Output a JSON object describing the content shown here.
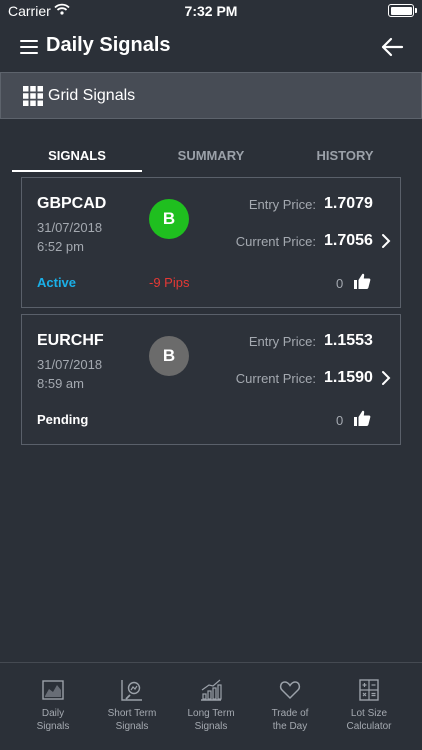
{
  "status_bar": {
    "carrier": "Carrier",
    "time": "7:32 PM"
  },
  "nav": {
    "title": "Daily Signals",
    "menu_icon": "hamburger-menu-icon",
    "back_icon": "arrow-left-icon"
  },
  "sub_header": {
    "label": "Grid Signals",
    "icon": "grid-icon"
  },
  "tabs": [
    {
      "label": "SIGNALS",
      "active": true
    },
    {
      "label": "SUMMARY",
      "active": false
    },
    {
      "label": "HISTORY",
      "active": false
    }
  ],
  "signals": [
    {
      "pair": "GBPCAD",
      "date": "31/07/2018",
      "time": "6:52 pm",
      "badge": "B",
      "badge_color": "#1fbf1f",
      "entry_label": "Entry Price:",
      "entry_price": "1.7079",
      "current_label": "Current Price:",
      "current_price": "1.7056",
      "status": "Active",
      "status_color": "#1ab0e8",
      "pips": "-9 Pips",
      "pips_color": "#e53935",
      "likes": "0"
    },
    {
      "pair": "EURCHF",
      "date": "31/07/2018",
      "time": "8:59 am",
      "badge": "B",
      "badge_color": "#6b6b6b",
      "entry_label": "Entry Price:",
      "entry_price": "1.1553",
      "current_label": "Current Price:",
      "current_price": "1.1590",
      "status": "Pending",
      "status_color": "#ffffff",
      "pips": "",
      "likes": "0"
    }
  ],
  "bottom_nav": [
    {
      "label": "Daily\nSignals",
      "icon": "chart-area-icon"
    },
    {
      "label": "Short Term\nSignals",
      "icon": "chart-magnifier-icon"
    },
    {
      "label": "Long Term\nSignals",
      "icon": "bar-chart-rising-icon"
    },
    {
      "label": "Trade of\nthe Day",
      "icon": "heart-icon"
    },
    {
      "label": "Lot Size\nCalculator",
      "icon": "calculator-icon"
    }
  ]
}
